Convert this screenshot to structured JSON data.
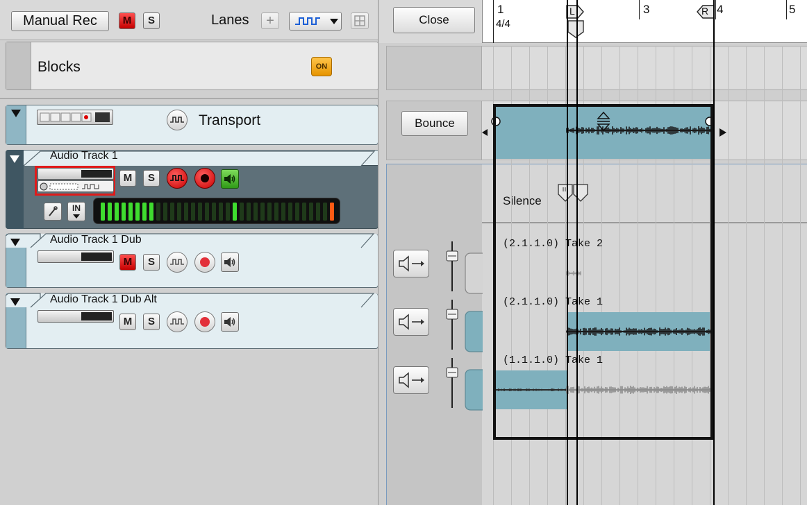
{
  "toolbar": {
    "manual_rec_label": "Manual Rec",
    "mute_label": "M",
    "solo_label": "S",
    "lanes_label": "Lanes",
    "add_lane_label": "+"
  },
  "blocks": {
    "label": "Blocks",
    "on_label": "ON"
  },
  "tracks": [
    {
      "name": "Transport"
    },
    {
      "name": "Audio Track 1",
      "mute": "M",
      "solo": "S",
      "input_label": "IN"
    },
    {
      "name": "Audio Track 1 Dub",
      "mute": "M",
      "solo": "S"
    },
    {
      "name": "Audio Track 1 Dub Alt",
      "mute": "M",
      "solo": "S"
    }
  ],
  "sequencer": {
    "close_label": "Close",
    "bounce_label": "Bounce",
    "time_signature": "4/4",
    "bars": [
      "1",
      "3",
      "4",
      "5"
    ],
    "left_locator": "L",
    "right_locator": "R",
    "silence_label": "Silence",
    "lanes": [
      {
        "label": "(2.1.1.0) Take 2"
      },
      {
        "label": "(2.1.1.0) Take 1"
      },
      {
        "label": "(1.1.1.0) Take 1"
      }
    ]
  },
  "colors": {
    "clip": "#7fb0bd",
    "mute_active": "#e01b1b",
    "meter_green": "#3fdc2f",
    "meter_peak": "#ff5a14",
    "on_badge": "#f4a81c"
  }
}
